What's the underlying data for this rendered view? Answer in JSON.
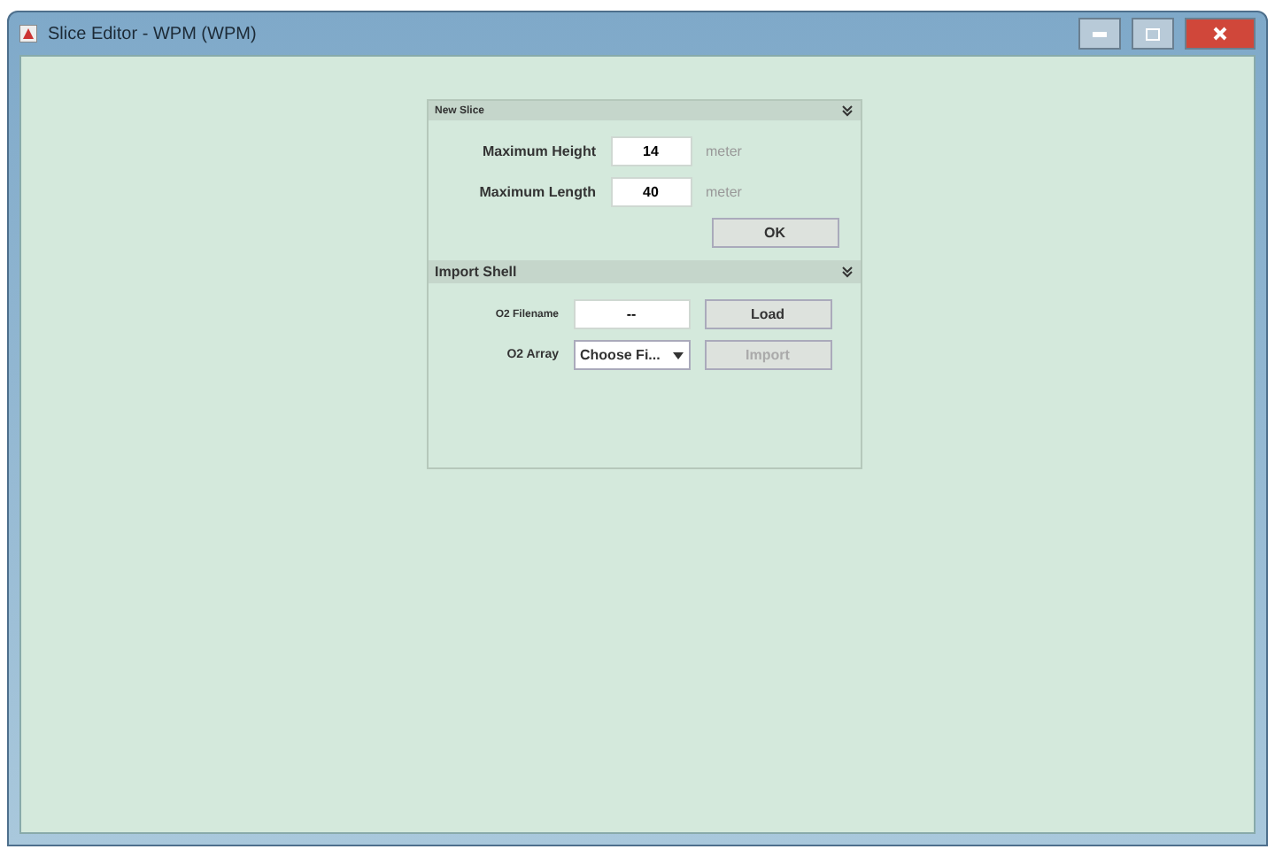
{
  "window": {
    "title": "Slice Editor - WPM (WPM)"
  },
  "sections": [
    {
      "title": "New Slice",
      "expanded": true,
      "rows": [
        {
          "kind": "field",
          "label": "Maximum Height",
          "value": "14",
          "unit": "meter"
        },
        {
          "kind": "field",
          "label": "Maximum Length",
          "value": "40",
          "unit": "meter"
        },
        {
          "kind": "button",
          "label": "OK",
          "disabled": false
        }
      ]
    },
    {
      "title": "Import Shell",
      "expanded": true,
      "rows": [
        {
          "kind": "file",
          "label": "O2 Filename",
          "value": "--",
          "button": "Load",
          "disabled": false
        },
        {
          "kind": "select",
          "label": "O2 Array",
          "value": "Choose Fi...",
          "button": "Import",
          "disabled": true
        }
      ]
    }
  ]
}
